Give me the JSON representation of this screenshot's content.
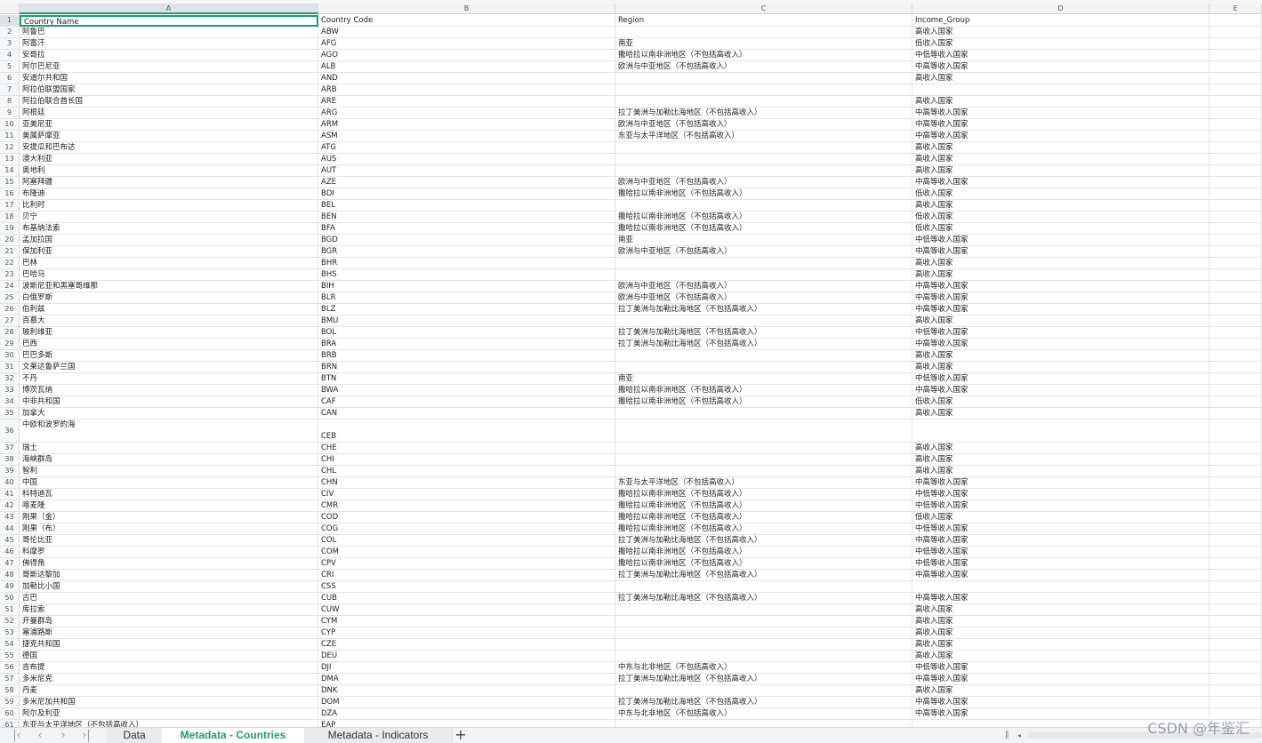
{
  "columns": [
    "A",
    "B",
    "C",
    "D",
    "E"
  ],
  "selected_column": "A",
  "rows": [
    {
      "num": "1",
      "a": "Country Name",
      "b": "Country Code",
      "c": "Region",
      "d": "Income_Group"
    },
    {
      "num": "2",
      "a": "阿鲁巴",
      "b": "ABW",
      "c": "",
      "d": "高收入国家"
    },
    {
      "num": "3",
      "a": "阿富汗",
      "b": "AFG",
      "c": "南亚",
      "d": "低收入国家"
    },
    {
      "num": "4",
      "a": "安哥拉",
      "b": "AGO",
      "c": "撒哈拉以南非洲地区（不包括高收入）",
      "d": "中低等收入国家"
    },
    {
      "num": "5",
      "a": "阿尔巴尼亚",
      "b": "ALB",
      "c": "欧洲与中亚地区（不包括高收入）",
      "d": "中高等收入国家"
    },
    {
      "num": "6",
      "a": "安道尔共和国",
      "b": "AND",
      "c": "",
      "d": "高收入国家"
    },
    {
      "num": "7",
      "a": "阿拉伯联盟国家",
      "b": "ARB",
      "c": "",
      "d": ""
    },
    {
      "num": "8",
      "a": "阿拉伯联合酋长国",
      "b": "ARE",
      "c": "",
      "d": "高收入国家"
    },
    {
      "num": "9",
      "a": "阿根廷",
      "b": "ARG",
      "c": "拉丁美洲与加勒比海地区（不包括高收入）",
      "d": "中高等收入国家"
    },
    {
      "num": "10",
      "a": "亚美尼亚",
      "b": "ARM",
      "c": "欧洲与中亚地区（不包括高收入）",
      "d": "中高等收入国家"
    },
    {
      "num": "11",
      "a": "美属萨摩亚",
      "b": "ASM",
      "c": "东亚与太平洋地区（不包括高收入）",
      "d": "中高等收入国家"
    },
    {
      "num": "12",
      "a": "安提瓜和巴布达",
      "b": "ATG",
      "c": "",
      "d": "高收入国家"
    },
    {
      "num": "13",
      "a": "澳大利亚",
      "b": "AUS",
      "c": "",
      "d": "高收入国家"
    },
    {
      "num": "14",
      "a": "奥地利",
      "b": "AUT",
      "c": "",
      "d": "高收入国家"
    },
    {
      "num": "15",
      "a": "阿塞拜疆",
      "b": "AZE",
      "c": "欧洲与中亚地区（不包括高收入）",
      "d": "中高等收入国家"
    },
    {
      "num": "16",
      "a": "布隆迪",
      "b": "BDI",
      "c": "撒哈拉以南非洲地区（不包括高收入）",
      "d": "低收入国家"
    },
    {
      "num": "17",
      "a": "比利时",
      "b": "BEL",
      "c": "",
      "d": "高收入国家"
    },
    {
      "num": "18",
      "a": "贝宁",
      "b": "BEN",
      "c": "撒哈拉以南非洲地区（不包括高收入）",
      "d": "低收入国家"
    },
    {
      "num": "19",
      "a": "布基纳法索",
      "b": "BFA",
      "c": "撒哈拉以南非洲地区（不包括高收入）",
      "d": "低收入国家"
    },
    {
      "num": "20",
      "a": "孟加拉国",
      "b": "BGD",
      "c": "南亚",
      "d": "中低等收入国家"
    },
    {
      "num": "21",
      "a": "保加利亚",
      "b": "BGR",
      "c": "欧洲与中亚地区（不包括高收入）",
      "d": "中高等收入国家"
    },
    {
      "num": "22",
      "a": "巴林",
      "b": "BHR",
      "c": "",
      "d": "高收入国家"
    },
    {
      "num": "23",
      "a": "巴哈马",
      "b": "BHS",
      "c": "",
      "d": "高收入国家"
    },
    {
      "num": "24",
      "a": "波斯尼亚和黑塞哥维那",
      "b": "BIH",
      "c": "欧洲与中亚地区（不包括高收入）",
      "d": "中高等收入国家"
    },
    {
      "num": "25",
      "a": "白俄罗斯",
      "b": "BLR",
      "c": "欧洲与中亚地区（不包括高收入）",
      "d": "中高等收入国家"
    },
    {
      "num": "26",
      "a": "伯利兹",
      "b": "BLZ",
      "c": "拉丁美洲与加勒比海地区（不包括高收入）",
      "d": "中高等收入国家"
    },
    {
      "num": "27",
      "a": "百慕大",
      "b": "BMU",
      "c": "",
      "d": "高收入国家"
    },
    {
      "num": "28",
      "a": "玻利维亚",
      "b": "BOL",
      "c": "拉丁美洲与加勒比海地区（不包括高收入）",
      "d": "中低等收入国家"
    },
    {
      "num": "29",
      "a": "巴西",
      "b": "BRA",
      "c": "拉丁美洲与加勒比海地区（不包括高收入）",
      "d": "中高等收入国家"
    },
    {
      "num": "30",
      "a": "巴巴多斯",
      "b": "BRB",
      "c": "",
      "d": "高收入国家"
    },
    {
      "num": "31",
      "a": "文莱达鲁萨兰国",
      "b": "BRN",
      "c": "",
      "d": "高收入国家"
    },
    {
      "num": "32",
      "a": "不丹",
      "b": "BTN",
      "c": "南亚",
      "d": "中低等收入国家"
    },
    {
      "num": "33",
      "a": "博茨瓦纳",
      "b": "BWA",
      "c": "撒哈拉以南非洲地区（不包括高收入）",
      "d": "中高等收入国家"
    },
    {
      "num": "34",
      "a": "中非共和国",
      "b": "CAF",
      "c": "撒哈拉以南非洲地区（不包括高收入）",
      "d": "低收入国家"
    },
    {
      "num": "35",
      "a": "加拿大",
      "b": "CAN",
      "c": "",
      "d": "高收入国家"
    },
    {
      "num": "36",
      "a": "中欧和波罗的海",
      "b": "CEB",
      "c": "",
      "d": "",
      "tall": true
    },
    {
      "num": "37",
      "a": "瑞士",
      "b": "CHE",
      "c": "",
      "d": "高收入国家"
    },
    {
      "num": "38",
      "a": "海峡群岛",
      "b": "CHI",
      "c": "",
      "d": "高收入国家"
    },
    {
      "num": "39",
      "a": "智利",
      "b": "CHL",
      "c": "",
      "d": "高收入国家"
    },
    {
      "num": "40",
      "a": "中国",
      "b": "CHN",
      "c": "东亚与太平洋地区（不包括高收入）",
      "d": "中高等收入国家"
    },
    {
      "num": "41",
      "a": "科特迪瓦",
      "b": "CIV",
      "c": "撒哈拉以南非洲地区（不包括高收入）",
      "d": "中低等收入国家"
    },
    {
      "num": "42",
      "a": "喀麦隆",
      "b": "CMR",
      "c": "撒哈拉以南非洲地区（不包括高收入）",
      "d": "中低等收入国家"
    },
    {
      "num": "43",
      "a": "刚果（金）",
      "b": "COD",
      "c": "撒哈拉以南非洲地区（不包括高收入）",
      "d": "低收入国家"
    },
    {
      "num": "44",
      "a": "刚果（布）",
      "b": "COG",
      "c": "撒哈拉以南非洲地区（不包括高收入）",
      "d": "中低等收入国家"
    },
    {
      "num": "45",
      "a": "哥伦比亚",
      "b": "COL",
      "c": "拉丁美洲与加勒比海地区（不包括高收入）",
      "d": "中高等收入国家"
    },
    {
      "num": "46",
      "a": "科摩罗",
      "b": "COM",
      "c": "撒哈拉以南非洲地区（不包括高收入）",
      "d": "中低等收入国家"
    },
    {
      "num": "47",
      "a": "佛得角",
      "b": "CPV",
      "c": "撒哈拉以南非洲地区（不包括高收入）",
      "d": "中低等收入国家"
    },
    {
      "num": "48",
      "a": "哥斯达黎加",
      "b": "CRI",
      "c": "拉丁美洲与加勒比海地区（不包括高收入）",
      "d": "中高等收入国家"
    },
    {
      "num": "49",
      "a": "加勒比小国",
      "b": "CSS",
      "c": "",
      "d": ""
    },
    {
      "num": "50",
      "a": "古巴",
      "b": "CUB",
      "c": "拉丁美洲与加勒比海地区（不包括高收入）",
      "d": "中高等收入国家"
    },
    {
      "num": "51",
      "a": "库拉索",
      "b": "CUW",
      "c": "",
      "d": "高收入国家"
    },
    {
      "num": "52",
      "a": "开曼群岛",
      "b": "CYM",
      "c": "",
      "d": "高收入国家"
    },
    {
      "num": "53",
      "a": "塞浦路斯",
      "b": "CYP",
      "c": "",
      "d": "高收入国家"
    },
    {
      "num": "54",
      "a": "捷克共和国",
      "b": "CZE",
      "c": "",
      "d": "高收入国家"
    },
    {
      "num": "55",
      "a": "德国",
      "b": "DEU",
      "c": "",
      "d": "高收入国家"
    },
    {
      "num": "56",
      "a": "吉布提",
      "b": "DJI",
      "c": "中东与北非地区（不包括高收入）",
      "d": "中低等收入国家"
    },
    {
      "num": "57",
      "a": "多米尼克",
      "b": "DMA",
      "c": "拉丁美洲与加勒比海地区（不包括高收入）",
      "d": "中高等收入国家"
    },
    {
      "num": "58",
      "a": "丹麦",
      "b": "DNK",
      "c": "",
      "d": "高收入国家"
    },
    {
      "num": "59",
      "a": "多米尼加共和国",
      "b": "DOM",
      "c": "拉丁美洲与加勒比海地区（不包括高收入）",
      "d": "中高等收入国家"
    },
    {
      "num": "60",
      "a": "阿尔及利亚",
      "b": "DZA",
      "c": "中东与北非地区（不包括高收入）",
      "d": "中高等收入国家"
    },
    {
      "num": "61",
      "a": "东亚与太平洋地区（不包括高收入）",
      "b": "EAP",
      "c": "",
      "d": ""
    }
  ],
  "tabs": [
    {
      "label": "Data",
      "active": false
    },
    {
      "label": "Metadata - Countries",
      "active": true
    },
    {
      "label": "Metadata - Indicators",
      "active": false
    }
  ],
  "nav_icons": [
    "first-sheet-icon",
    "prev-sheet-icon",
    "next-sheet-icon",
    "last-sheet-icon"
  ],
  "watermark": "CSDN @年鉴汇",
  "colors": {
    "accent": "#1e9c6c",
    "grid": "#e0e3e6",
    "header_bg": "#f2f3f4"
  }
}
